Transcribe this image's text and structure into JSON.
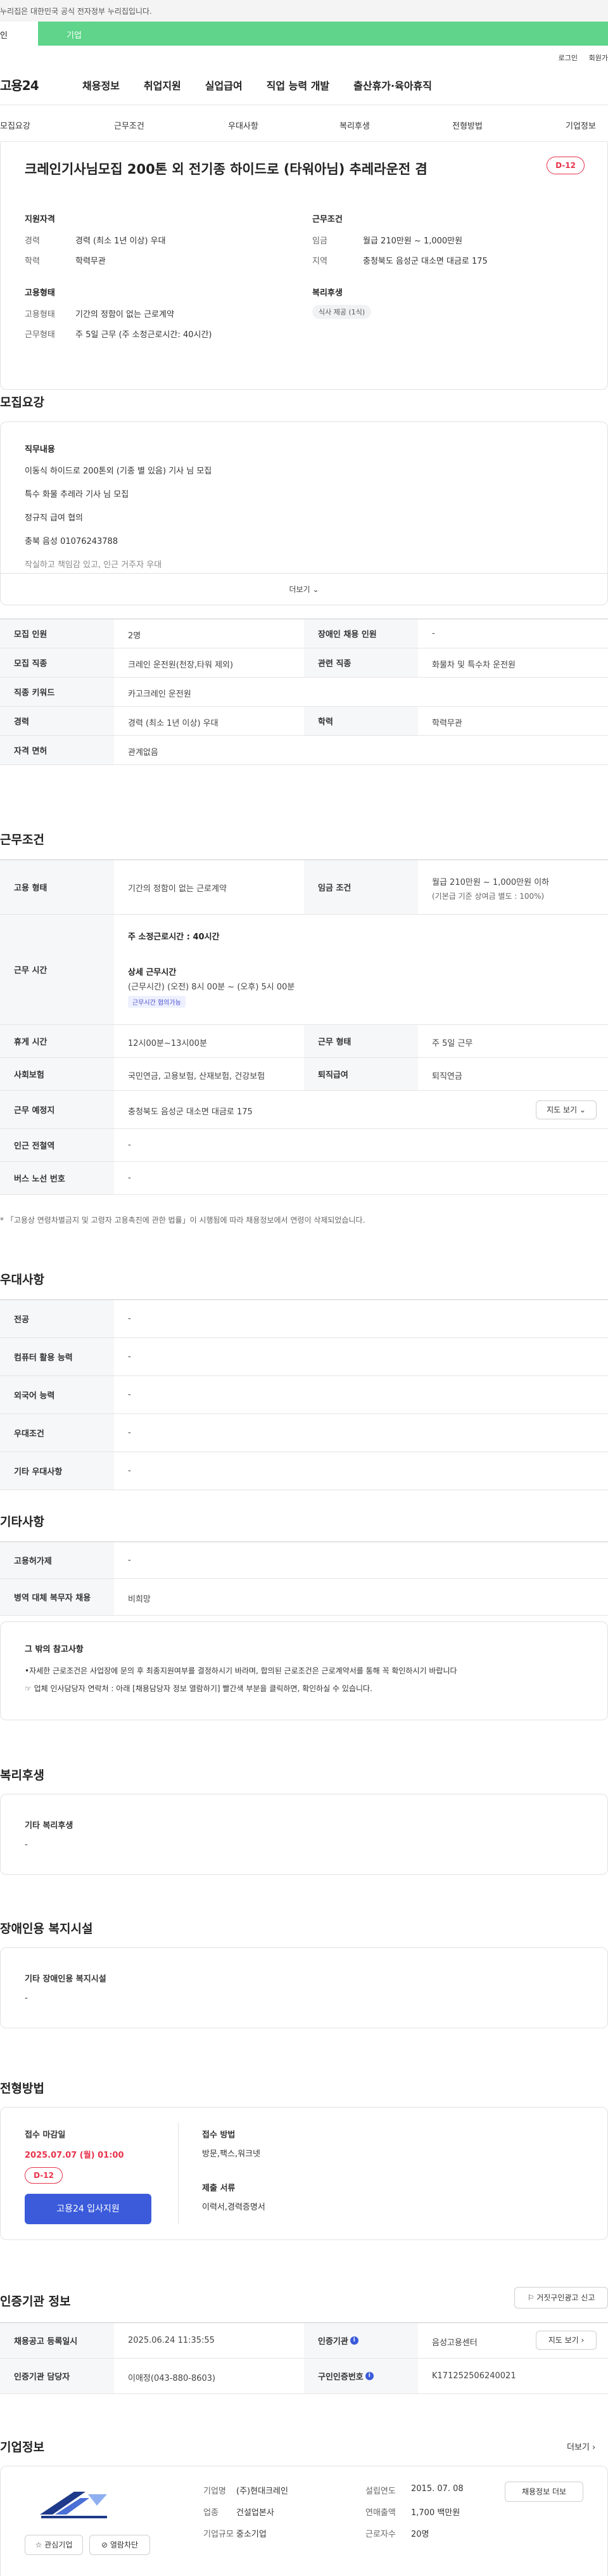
{
  "top_notice": "누리집은 대한민국 공식 전자정부 누리집입니다.",
  "tabs": {
    "individual": "인",
    "business": "기업"
  },
  "util": {
    "login": "로그인",
    "join": "회원가"
  },
  "gnb": {
    "logo": "고용24",
    "menu": [
      "채용정보",
      "취업지원",
      "실업급여",
      "직업 능력 개발",
      "출산휴가·육아휴직"
    ]
  },
  "subnav": [
    "모집요강",
    "근무조건",
    "우대사항",
    "복리후생",
    "전형방법",
    "기업정보"
  ],
  "summary": {
    "title": "크레인기사님모집 200톤 외 전기종 하이드로 (타워아님) 추레라운전 겸",
    "dday": "D-12",
    "qual": {
      "heading": "지원자격",
      "rows": [
        [
          "경력",
          "경력 (최소 1년 이상) 우대"
        ],
        [
          "학력",
          "학력무관"
        ]
      ]
    },
    "cond": {
      "heading": "근무조건",
      "rows": [
        [
          "임금",
          "월급 210만원 ~ 1,000만원"
        ],
        [
          "지역",
          "충청북도 음성군 대소면 대금로 175"
        ]
      ]
    },
    "emp": {
      "heading": "고용형태",
      "rows": [
        [
          "고용형태",
          "기간의 정함이 없는 근로계약"
        ],
        [
          "근무형태",
          "주 5일 근무 (주 소정근로시간: 40시간)"
        ]
      ]
    },
    "welfare": {
      "heading": "복리후생",
      "chip": "식사 제공 (1식)"
    }
  },
  "recruit": {
    "title": "모집요강",
    "detail_heading": "직무내용",
    "lines": [
      "이동식 하이드로 200톤외 (기종 별 있음) 기사 님 모집",
      "특수 화물 추레라 기사 님 모집",
      "정규직 급여 협의",
      "충북 음성 01076243788",
      "작실하고 책임감 있고, 인근 거주자 우대"
    ],
    "more": "더보기",
    "table": [
      [
        [
          "모집 인원",
          "2명"
        ],
        [
          "장애인 채용 인원",
          "-"
        ]
      ],
      [
        [
          "모집 직종",
          "크레인 운전원(천장,타워 제외)"
        ],
        [
          "관련 직종",
          "화물차 및 특수차 운전원"
        ]
      ],
      [
        [
          "직종 키워드",
          "카고크레인 운전원"
        ]
      ],
      [
        [
          "경력",
          "경력 (최소 1년 이상) 우대"
        ],
        [
          "학력",
          "학력무관"
        ]
      ],
      [
        [
          "자격 면허",
          "관계없음"
        ]
      ]
    ]
  },
  "work": {
    "title": "근무조건",
    "emp_type_label": "고용 형태",
    "emp_type": "기간의 정함이 없는 근로계약",
    "wage_label": "임금 조건",
    "wage": "월급 210만원 ~ 1,000만원 이하",
    "wage_note": "(기본급 기준 상여금 별도 : 100%)",
    "hours_label": "근무 시간",
    "hours_weekly": "주 소정근로시간 : 40시간",
    "hours_detail_h": "상세 근무시간",
    "hours_detail": "(근무시간) (오전) 8시 00분 ~ (오후) 5시 00분",
    "hours_badge": "근무시간 협의가능",
    "rows": [
      [
        [
          "휴게 시간",
          "12시00분~13시00분"
        ],
        [
          "근무 형태",
          "주 5일 근무"
        ]
      ],
      [
        [
          "사회보험",
          "국민연금, 고용보험, 산재보험, 건강보험"
        ],
        [
          "퇴직급여",
          "퇴직연금"
        ]
      ],
      [
        [
          "근무 예정지",
          "충청북도 음성군 대소면 대금로 175"
        ]
      ],
      [
        [
          "인근 전철역",
          "-"
        ]
      ],
      [
        [
          "버스 노선 번호",
          "-"
        ]
      ]
    ],
    "map_btn": "지도 보기",
    "note": "* 「고용상 연령차별금지 및 고령자 고용촉진에 관한 법률」이 시행됨에 따라 채용정보에서 연령이 삭제되었습니다."
  },
  "pref": {
    "title": "우대사항",
    "rows": [
      [
        "전공",
        "-"
      ],
      [
        "컴퓨터 활용 능력",
        "-"
      ],
      [
        "외국어 능력",
        "-"
      ],
      [
        "우대조건",
        "-"
      ],
      [
        "기타 우대사항",
        "-"
      ]
    ]
  },
  "etc": {
    "title": "기타사항",
    "rows": [
      [
        "고용허가제",
        "-"
      ],
      [
        "병역 대체 복무자 채용",
        "비희망"
      ]
    ],
    "box_h": "그 밖의 참고사항",
    "box_lines": [
      "•자세한 근로조건은 사업장에 문의 후 최종지원여부를 결정하시기 바라며, 합의된 근로조건은 근로계약서를 통해 꼭 확인하시기 바랍니다",
      "☞ 업체 인사담당자 연락처 : 아래 [채용담당자 정보 열람하기] 빨간색 부분을 클릭하면, 확인하실 수 있습니다."
    ]
  },
  "welfare": {
    "title": "복리후생",
    "box_h": "기타 복리후생",
    "value": "-"
  },
  "disabled": {
    "title": "장애인용 복지시설",
    "box_h": "기타 장애인용 복지시설",
    "value": "-"
  },
  "screen": {
    "title": "전형방법",
    "deadline_h": "접수 마감일",
    "deadline": "2025.07.07 (월) 01:00",
    "dday": "D-12",
    "apply_btn": "고용24 입사지원",
    "method_h": "접수 방법",
    "method": "방문,팩스,워크넷",
    "docs_h": "제출 서류",
    "docs": "이력서,경력증명서"
  },
  "cert": {
    "title": "인증기관 정보",
    "report_btn": "거짓구인광고 신고",
    "rows": [
      [
        [
          "채용공고 등록일시",
          "2025.06.24 11:35:55"
        ],
        [
          "인증기관",
          "음성고용센터"
        ]
      ],
      [
        [
          "인증기관 담당자",
          "이애정(043-880-8603)"
        ],
        [
          "구인인증번호",
          "K171252506240021"
        ]
      ]
    ],
    "map_btn": "지도 보기"
  },
  "company": {
    "title": "기업정보",
    "more": "더보기",
    "info": [
      [
        [
          "기업명",
          "(주)현대크레인"
        ],
        [
          "설립연도",
          "2015. 07. 08"
        ]
      ],
      [
        [
          "업종",
          "건설업본사"
        ],
        [
          "연매출액",
          "1,700 백만원"
        ]
      ],
      [
        [
          "기업규모",
          "중소기업"
        ],
        [
          "근로자수",
          "20명"
        ]
      ]
    ],
    "interest_btn": "관심기업",
    "block_btn": "열람차단",
    "contact_btn": "채용정보 더보"
  }
}
